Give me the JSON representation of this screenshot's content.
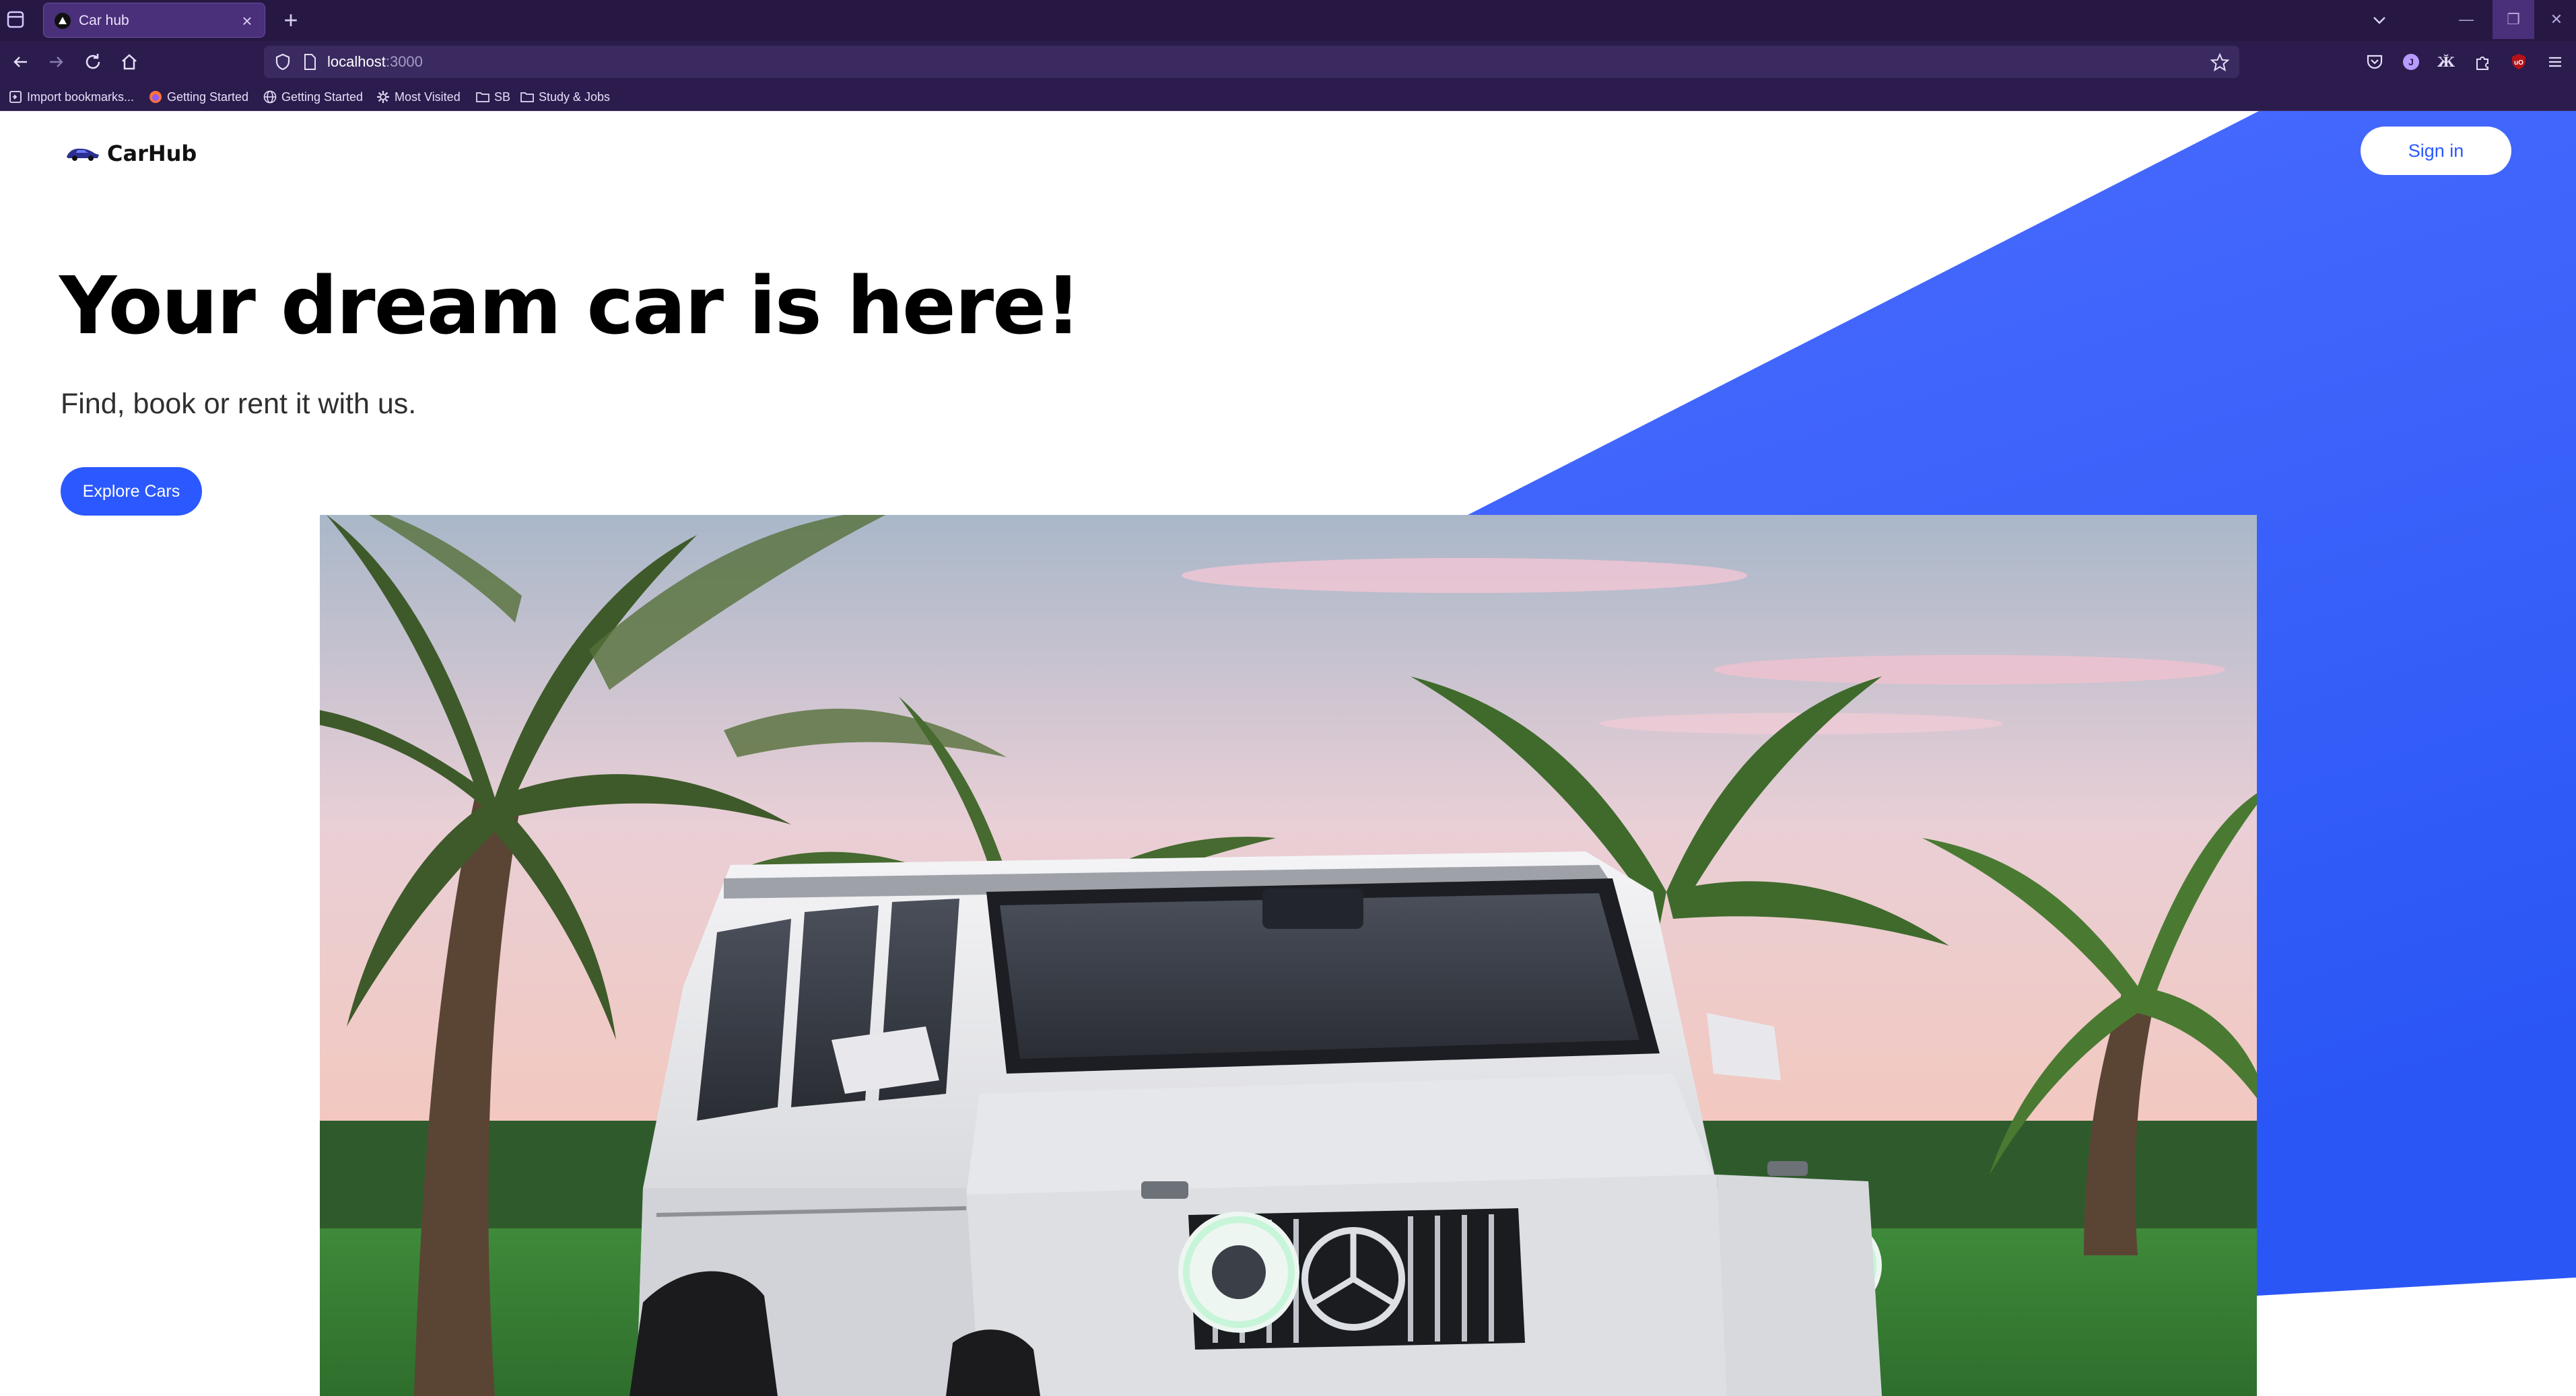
{
  "browser": {
    "tab_title": "Car hub",
    "url_host": "localhost",
    "url_port": ":3000",
    "bookmarks": [
      "Import bookmarks...",
      "Getting Started",
      "Getting Started",
      "Most Visited",
      "SB",
      "Study & Jobs"
    ],
    "accent_color": "#4a2f7a"
  },
  "site": {
    "logo_text": "CarHub",
    "signin_label": "Sign in",
    "hero_title": "Your dream car is here!",
    "hero_subtitle": "Find, book or rent it with us.",
    "explore_label": "Explore Cars",
    "brand_color": "#2b59ff",
    "hero_image": "white-suv-with-palm-trees"
  }
}
